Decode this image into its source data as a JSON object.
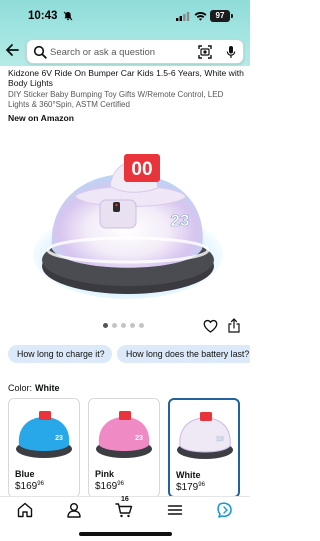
{
  "status_bar": {
    "time": "10:43",
    "battery": "97",
    "icons": [
      "bell-slash-icon",
      "cellular-signal-icon",
      "wifi-icon",
      "battery-icon"
    ]
  },
  "search": {
    "placeholder": "Search or ask a question",
    "icons": [
      "back-arrow-icon",
      "search-icon",
      "camera-lens-icon",
      "microphone-icon"
    ]
  },
  "product": {
    "title": "Kidzone 6V Ride On Bumper Car Kids 1.5-6 Years, White with Body Lights",
    "subtitle": "DIY Sticker Baby Bumping Toy Gifts W/Remote Control, LED Lights & 360°Spin, ASTM Certified",
    "badge": "New on Amazon",
    "hero_sticker_number": "00",
    "hero_side_number": "23",
    "image_count": 5,
    "active_image_index": 0
  },
  "questions": [
    "How long to charge it?",
    "How long does the battery last?"
  ],
  "color_selector": {
    "label": "Color:",
    "selected": "White",
    "options": [
      {
        "name": "Blue",
        "price_dollars": "$169",
        "price_cents": "96",
        "body_color": "#28a8e8"
      },
      {
        "name": "Pink",
        "price_dollars": "$169",
        "price_cents": "96",
        "body_color": "#f08ac4"
      },
      {
        "name": "White",
        "price_dollars": "$179",
        "price_cents": "96",
        "body_color": "#efe9f5"
      }
    ]
  },
  "bottom_nav": {
    "cart_count": "16",
    "items": [
      "home-icon",
      "account-icon",
      "cart-icon",
      "menu-icon",
      "rufus-ai-icon"
    ]
  },
  "colors": {
    "header_teal": "#a6e6e2",
    "chip_blue": "#dbe9f8",
    "selected_border": "#2162a1",
    "sticker_red": "#e8343a"
  }
}
